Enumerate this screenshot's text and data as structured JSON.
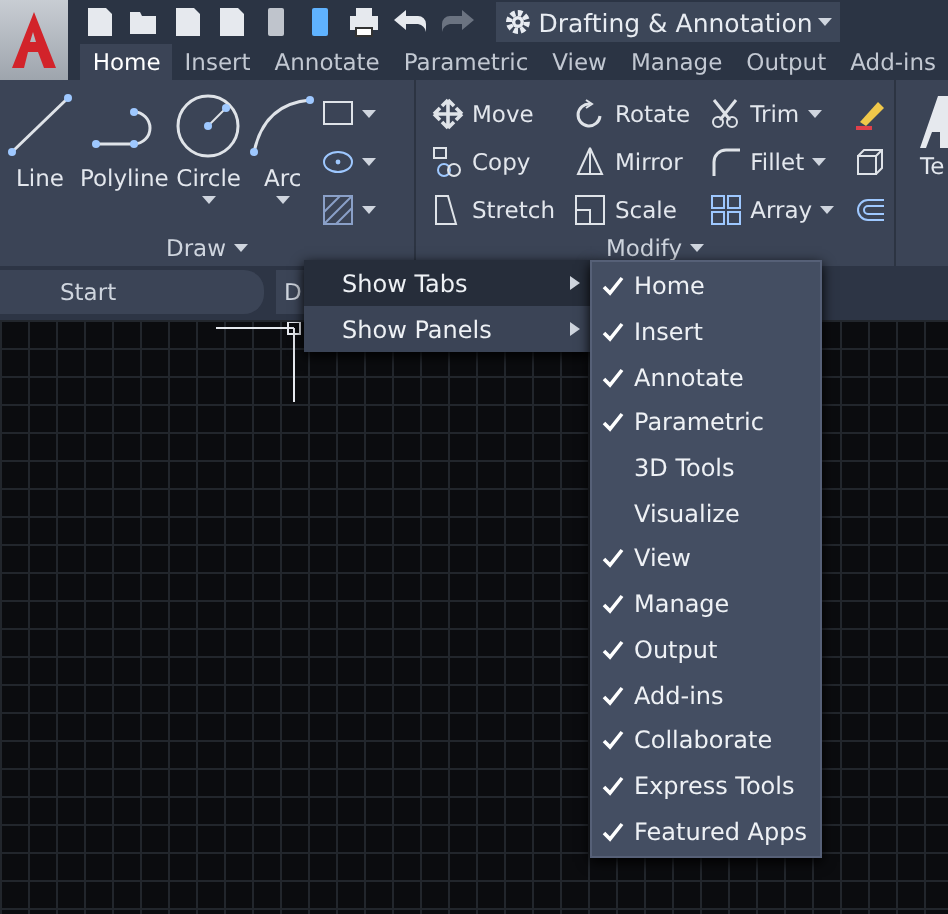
{
  "workspace": {
    "label": "Drafting & Annotation"
  },
  "ribbon_tabs": [
    {
      "label": "Home",
      "selected": true
    },
    {
      "label": "Insert",
      "selected": false
    },
    {
      "label": "Annotate",
      "selected": false
    },
    {
      "label": "Parametric",
      "selected": false
    },
    {
      "label": "View",
      "selected": false
    },
    {
      "label": "Manage",
      "selected": false
    },
    {
      "label": "Output",
      "selected": false
    },
    {
      "label": "Add-ins",
      "selected": false
    }
  ],
  "draw_panel": {
    "title": "Draw",
    "tools": [
      {
        "label": "Line",
        "dropdown": false
      },
      {
        "label": "Polyline",
        "dropdown": false
      },
      {
        "label": "Circle",
        "dropdown": true
      },
      {
        "label": "Arc",
        "dropdown": true
      }
    ]
  },
  "modify_panel": {
    "title": "Modify",
    "columns": [
      [
        {
          "label": "Move",
          "dropdown": false
        },
        {
          "label": "Copy",
          "dropdown": false
        },
        {
          "label": "Stretch",
          "dropdown": false
        }
      ],
      [
        {
          "label": "Rotate",
          "dropdown": false
        },
        {
          "label": "Mirror",
          "dropdown": false
        },
        {
          "label": "Scale",
          "dropdown": false
        }
      ],
      [
        {
          "label": "Trim",
          "dropdown": true
        },
        {
          "label": "Fillet",
          "dropdown": true
        },
        {
          "label": "Array",
          "dropdown": true
        }
      ]
    ]
  },
  "annotation_panel": {
    "label": "Te"
  },
  "file_tabs": [
    {
      "label": "Start"
    },
    {
      "label": "D"
    }
  ],
  "context_menu": [
    {
      "label": "Show Tabs",
      "selected": true
    },
    {
      "label": "Show Panels",
      "selected": false
    }
  ],
  "tabs_submenu": [
    {
      "label": "Home",
      "checked": true
    },
    {
      "label": "Insert",
      "checked": true
    },
    {
      "label": "Annotate",
      "checked": true
    },
    {
      "label": "Parametric",
      "checked": true
    },
    {
      "label": "3D Tools",
      "checked": false
    },
    {
      "label": "Visualize",
      "checked": false
    },
    {
      "label": "View",
      "checked": true
    },
    {
      "label": "Manage",
      "checked": true
    },
    {
      "label": "Output",
      "checked": true
    },
    {
      "label": "Add-ins",
      "checked": true
    },
    {
      "label": "Collaborate",
      "checked": true
    },
    {
      "label": "Express Tools",
      "checked": true
    },
    {
      "label": "Featured Apps",
      "checked": true
    }
  ]
}
